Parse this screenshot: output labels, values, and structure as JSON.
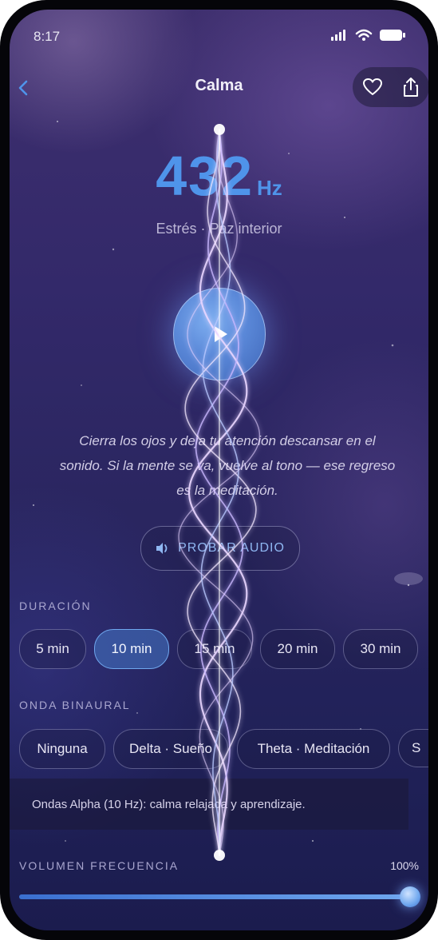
{
  "status_bar": {
    "time": "8:17"
  },
  "header": {
    "title": "Calma"
  },
  "frequency": {
    "value": "432",
    "unit": "Hz",
    "subtitle": "Estrés · Paz interior"
  },
  "meditation_text": "Cierra los ojos y deja tu atención descansar en el sonido. Si la mente se va, vuelve al tono — ese regreso es la meditación.",
  "probar_audio": {
    "label": "PROBAR AUDIO"
  },
  "duration": {
    "label": "DURACIÓN",
    "options": [
      "5 min",
      "10 min",
      "15 min",
      "20 min",
      "30 min"
    ],
    "selected": "10 min"
  },
  "binaural": {
    "label": "ONDA BINAURAL",
    "options": [
      "Ninguna",
      "Delta · Sueño",
      "Theta · Meditación",
      "S"
    ],
    "description": "Ondas Alpha (10 Hz): calma relajada y aprendizaje."
  },
  "volume": {
    "label": "VOLUMEN FRECUENCIA",
    "percent_text": "100%",
    "level": 1.0
  },
  "colors": {
    "accent": "#4f94ea",
    "background": "#2a2660",
    "selected_chip": "#4678c8"
  },
  "icons": [
    "chevron-left-icon",
    "heart-icon",
    "share-icon",
    "play-icon",
    "speaker-icon",
    "signal-icon",
    "wifi-icon",
    "battery-icon"
  ]
}
